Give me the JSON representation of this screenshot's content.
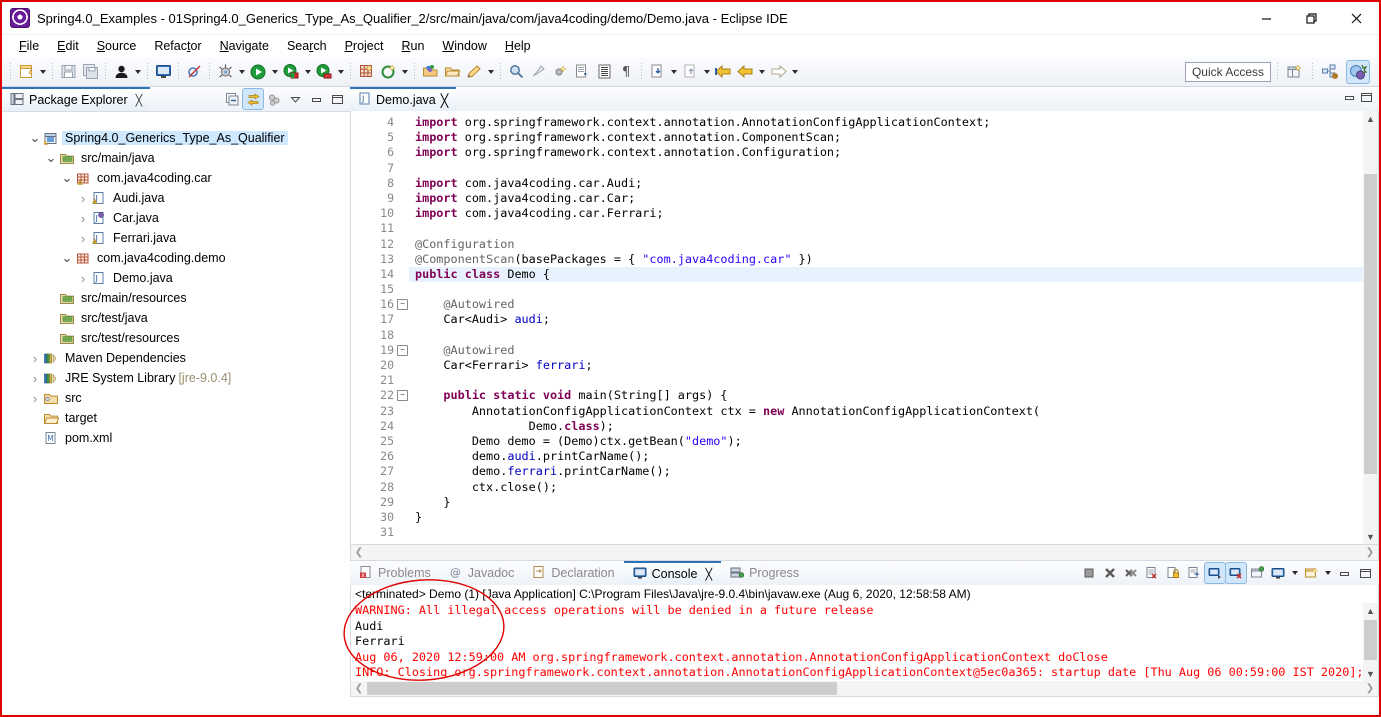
{
  "window": {
    "title": "Spring4.0_Examples - 01Spring4.0_Generics_Type_As_Qualifier_2/src/main/java/com/java4coding/demo/Demo.java - Eclipse IDE",
    "app_icon": "eclipse-icon",
    "minimize": "—",
    "maximize": "❐",
    "close": "✕"
  },
  "menu": [
    {
      "label": "File",
      "mnemonic": "F"
    },
    {
      "label": "Edit",
      "mnemonic": "E"
    },
    {
      "label": "Source",
      "mnemonic": "S"
    },
    {
      "label": "Refactor",
      "mnemonic": "t"
    },
    {
      "label": "Navigate",
      "mnemonic": "N"
    },
    {
      "label": "Search",
      "mnemonic": "r"
    },
    {
      "label": "Project",
      "mnemonic": "P"
    },
    {
      "label": "Run",
      "mnemonic": "R"
    },
    {
      "label": "Window",
      "mnemonic": "W"
    },
    {
      "label": "Help",
      "mnemonic": "H"
    }
  ],
  "toolbar": {
    "quick_access_placeholder": "Quick Access",
    "buttons": [
      "new-wizard-icon",
      "save-icon",
      "save-all-icon",
      "user-profile-icon",
      "open-console-icon",
      "skip-breakpoints-icon",
      "debug-icon",
      "run-icon",
      "run-external-tools-icon",
      "run-coverage-icon",
      "new-java-project-icon",
      "new-annotation-icon",
      "open-type-icon",
      "open-task-icon",
      "edit-icon",
      "search-icon",
      "pin-icon",
      "toggle-whitespace-icon",
      "externalize-strings-icon",
      "toggle-block-selection-icon",
      "show-whitespace-icon",
      "previous-annotation-icon",
      "next-annotation-icon",
      "last-edit-location-icon",
      "back-icon",
      "forward-icon"
    ],
    "perspective_buttons": [
      "open-perspective-icon",
      "java-perspective-icon",
      "debug-perspective-icon"
    ]
  },
  "package_explorer": {
    "tab_label": "Package Explorer",
    "tab_icon": "package-explorer-icon",
    "close_icon": "╳",
    "view_buttons": [
      "collapse-all-icon",
      "link-with-editor-icon",
      "view-menu-icon",
      "minimize-icon",
      "maximize-icon"
    ],
    "tree": [
      {
        "label": "Spring4.0_Generics_Type_As_Qualifier",
        "indent": 1,
        "twisty": "v",
        "icon": "maven-java-project-icon",
        "selected": true
      },
      {
        "label": "src/main/java",
        "indent": 2,
        "twisty": "v",
        "icon": "source-folder-icon"
      },
      {
        "label": "com.java4coding.car",
        "indent": 3,
        "twisty": "v",
        "icon": "package-warning-icon"
      },
      {
        "label": "Audi.java",
        "indent": 4,
        "twisty": ">",
        "icon": "java-file-warning-icon"
      },
      {
        "label": "Car.java",
        "indent": 4,
        "twisty": ">",
        "icon": "java-interface-file-icon"
      },
      {
        "label": "Ferrari.java",
        "indent": 4,
        "twisty": ">",
        "icon": "java-file-warning-icon"
      },
      {
        "label": "com.java4coding.demo",
        "indent": 3,
        "twisty": "v",
        "icon": "package-icon"
      },
      {
        "label": "Demo.java",
        "indent": 4,
        "twisty": ">",
        "icon": "java-file-icon"
      },
      {
        "label": "src/main/resources",
        "indent": 2,
        "twisty": "",
        "icon": "source-folder-icon"
      },
      {
        "label": "src/test/java",
        "indent": 2,
        "twisty": "",
        "icon": "source-folder-icon"
      },
      {
        "label": "src/test/resources",
        "indent": 2,
        "twisty": "",
        "icon": "source-folder-icon"
      },
      {
        "label": "Maven Dependencies",
        "indent": 1,
        "twisty": ">",
        "icon": "library-icon"
      },
      {
        "label": "JRE System Library",
        "suffix": " [jre-9.0.4]",
        "indent": 1,
        "twisty": ">",
        "icon": "library-icon"
      },
      {
        "label": "src",
        "indent": 1,
        "twisty": ">",
        "icon": "folder-closed-icon"
      },
      {
        "label": "target",
        "indent": 1,
        "twisty": "",
        "icon": "folder-open-icon"
      },
      {
        "label": "pom.xml",
        "indent": 1,
        "twisty": "",
        "icon": "xml-file-icon"
      }
    ]
  },
  "editor": {
    "tab_label": "Demo.java",
    "tab_icon": "java-file-icon",
    "close_icon": "╳",
    "minimize_icon": "−",
    "maximize_icon": "☐",
    "current_line": 14,
    "lines": [
      {
        "n": 4,
        "fold": "",
        "segs": [
          {
            "t": "import ",
            "c": "kw"
          },
          {
            "t": "org.springframework.context.annotation.AnnotationConfigApplicationContext;",
            "c": ""
          }
        ]
      },
      {
        "n": 5,
        "fold": "",
        "segs": [
          {
            "t": "import ",
            "c": "kw"
          },
          {
            "t": "org.springframework.context.annotation.ComponentScan;",
            "c": ""
          }
        ]
      },
      {
        "n": 6,
        "fold": "",
        "segs": [
          {
            "t": "import ",
            "c": "kw"
          },
          {
            "t": "org.springframework.context.annotation.Configuration;",
            "c": ""
          }
        ]
      },
      {
        "n": 7,
        "fold": "",
        "segs": []
      },
      {
        "n": 8,
        "fold": "",
        "segs": [
          {
            "t": "import ",
            "c": "kw"
          },
          {
            "t": "com.java4coding.car.Audi;",
            "c": ""
          }
        ]
      },
      {
        "n": 9,
        "fold": "",
        "segs": [
          {
            "t": "import ",
            "c": "kw"
          },
          {
            "t": "com.java4coding.car.Car;",
            "c": ""
          }
        ]
      },
      {
        "n": 10,
        "fold": "",
        "segs": [
          {
            "t": "import ",
            "c": "kw"
          },
          {
            "t": "com.java4coding.car.Ferrari;",
            "c": ""
          }
        ]
      },
      {
        "n": 11,
        "fold": "",
        "segs": []
      },
      {
        "n": 12,
        "fold": "",
        "segs": [
          {
            "t": "@Configuration",
            "c": "ann"
          }
        ]
      },
      {
        "n": 13,
        "fold": "",
        "segs": [
          {
            "t": "@ComponentScan",
            "c": "ann"
          },
          {
            "t": "(basePackages = { ",
            "c": ""
          },
          {
            "t": "\"com.java4coding.car\"",
            "c": "str"
          },
          {
            "t": " })",
            "c": ""
          }
        ]
      },
      {
        "n": 14,
        "fold": "",
        "segs": [
          {
            "t": "public class ",
            "c": "kw"
          },
          {
            "t": "Demo {",
            "c": ""
          }
        ]
      },
      {
        "n": 15,
        "fold": "",
        "segs": []
      },
      {
        "n": 16,
        "fold": "-",
        "segs": [
          {
            "t": "    @Autowired",
            "c": "ann"
          }
        ]
      },
      {
        "n": 17,
        "fold": "",
        "segs": [
          {
            "t": "    Car<Audi> ",
            "c": ""
          },
          {
            "t": "audi",
            "c": "fld"
          },
          {
            "t": ";",
            "c": ""
          }
        ]
      },
      {
        "n": 18,
        "fold": "",
        "segs": []
      },
      {
        "n": 19,
        "fold": "-",
        "segs": [
          {
            "t": "    @Autowired",
            "c": "ann"
          }
        ]
      },
      {
        "n": 20,
        "fold": "",
        "segs": [
          {
            "t": "    Car<Ferrari> ",
            "c": ""
          },
          {
            "t": "ferrari",
            "c": "fld"
          },
          {
            "t": ";",
            "c": ""
          }
        ]
      },
      {
        "n": 21,
        "fold": "",
        "segs": []
      },
      {
        "n": 22,
        "fold": "-",
        "segs": [
          {
            "t": "    ",
            "c": ""
          },
          {
            "t": "public static void ",
            "c": "kw"
          },
          {
            "t": "main(String[] args) {",
            "c": ""
          }
        ]
      },
      {
        "n": 23,
        "fold": "",
        "segs": [
          {
            "t": "        AnnotationConfigApplicationContext ctx = ",
            "c": ""
          },
          {
            "t": "new ",
            "c": "kw"
          },
          {
            "t": "AnnotationConfigApplicationContext(",
            "c": ""
          }
        ]
      },
      {
        "n": 24,
        "fold": "",
        "segs": [
          {
            "t": "                Demo.",
            "c": ""
          },
          {
            "t": "class",
            "c": "kw"
          },
          {
            "t": ");",
            "c": ""
          }
        ]
      },
      {
        "n": 25,
        "fold": "",
        "segs": [
          {
            "t": "        Demo demo = (Demo)ctx.getBean(",
            "c": ""
          },
          {
            "t": "\"demo\"",
            "c": "str"
          },
          {
            "t": ");",
            "c": ""
          }
        ]
      },
      {
        "n": 26,
        "fold": "",
        "segs": [
          {
            "t": "        demo.",
            "c": ""
          },
          {
            "t": "audi",
            "c": "fld"
          },
          {
            "t": ".printCarName();",
            "c": ""
          }
        ]
      },
      {
        "n": 27,
        "fold": "",
        "segs": [
          {
            "t": "        demo.",
            "c": ""
          },
          {
            "t": "ferrari",
            "c": "fld"
          },
          {
            "t": ".printCarName();",
            "c": ""
          }
        ]
      },
      {
        "n": 28,
        "fold": "",
        "segs": [
          {
            "t": "        ctx.close();",
            "c": ""
          }
        ]
      },
      {
        "n": 29,
        "fold": "",
        "segs": [
          {
            "t": "    }",
            "c": ""
          }
        ]
      },
      {
        "n": 30,
        "fold": "",
        "segs": [
          {
            "t": "}",
            "c": ""
          }
        ]
      },
      {
        "n": 31,
        "fold": "",
        "segs": []
      }
    ]
  },
  "console_panel": {
    "tabs": [
      {
        "label": "Problems",
        "icon": "problems-icon",
        "active": false
      },
      {
        "label": "Javadoc",
        "icon": "javadoc-icon",
        "active": false
      },
      {
        "label": "Declaration",
        "icon": "declaration-icon",
        "active": false
      },
      {
        "label": "Console",
        "icon": "console-icon",
        "active": true
      },
      {
        "label": "Progress",
        "icon": "progress-icon",
        "active": false
      }
    ],
    "close_icon": "╳",
    "toolbar_buttons": [
      "terminate-icon",
      "remove-launch-icon",
      "remove-all-launches-icon",
      "clear-console-icon",
      "scroll-lock-icon",
      "word-wrap-icon",
      "show-console-on-output-icon",
      "show-console-on-error-icon",
      "pin-console-icon",
      "display-selected-console-icon",
      "open-console-icon",
      "minimize-icon",
      "maximize-icon"
    ],
    "terminated_line": "<terminated> Demo (1) [Java Application] C:\\Program Files\\Java\\jre-9.0.4\\bin\\javaw.exe (Aug 6, 2020, 12:58:58 AM)",
    "output": [
      {
        "text": "WARNING: All illegal access operations will be denied in a future release",
        "stream": "err"
      },
      {
        "text": "Audi",
        "stream": "out"
      },
      {
        "text": "Ferrari",
        "stream": "out"
      },
      {
        "text": "Aug 06, 2020 12:59:00 AM org.springframework.context.annotation.AnnotationConfigApplicationContext doClose",
        "stream": "err"
      },
      {
        "text": "INFO: Closing org.springframework.context.annotation.AnnotationConfigApplicationContext@5ec0a365: startup date [Thu Aug 06 00:59:00 IST 2020];",
        "stream": "err"
      }
    ]
  },
  "annotation": {
    "shape": "red-ellipse",
    "color": "#e00000"
  }
}
